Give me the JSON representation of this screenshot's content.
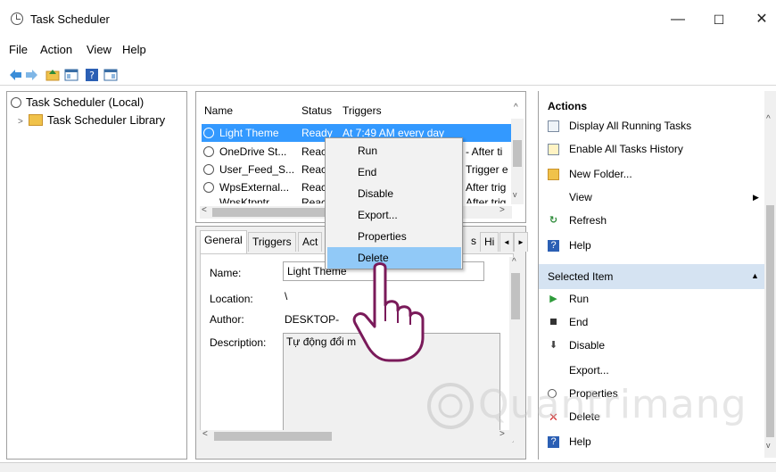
{
  "window": {
    "title": "Task Scheduler",
    "minimize": "—",
    "maximize": "☐",
    "close": "✕"
  },
  "menu": [
    "File",
    "Action",
    "View",
    "Help"
  ],
  "tree": {
    "root": "Task Scheduler (Local)",
    "library": "Task Scheduler Library"
  },
  "task_list": {
    "columns": [
      "Name",
      "Status",
      "Triggers"
    ],
    "rows": [
      {
        "name": "Light Theme",
        "status": "Ready",
        "trigger": "At 7:49 AM every day"
      },
      {
        "name": "OneDrive St...",
        "status": "Reac",
        "trigger": "- After ti"
      },
      {
        "name": "User_Feed_S...",
        "status": "Reac",
        "trigger": "Trigger e"
      },
      {
        "name": "WpsExternal...",
        "status": "Reac",
        "trigger": "After trig"
      },
      {
        "name": "WpsKtpntr...",
        "status": "Reac",
        "trigger": "After trig"
      }
    ]
  },
  "detail": {
    "tabs": [
      "General",
      "Triggers",
      "Act",
      "s",
      "Hi"
    ],
    "labels": {
      "name": "Name:",
      "location": "Location:",
      "author": "Author:",
      "description": "Description:"
    },
    "values": {
      "name": "Light Theme",
      "location": "\\",
      "author": "DESKTOP-",
      "description": "Tự động đổi m"
    }
  },
  "context_menu": [
    "Run",
    "End",
    "Disable",
    "Export...",
    "Properties",
    "Delete"
  ],
  "context_menu_highlighted": "Delete",
  "actions": {
    "header": "Actions",
    "items": [
      "Display All Running Tasks",
      "Enable All Tasks History",
      "New Folder...",
      "View",
      "Refresh",
      "Help"
    ],
    "selected_header": "Selected Item",
    "selected_items": [
      "Run",
      "End",
      "Disable",
      "Export...",
      "Properties",
      "Delete",
      "Help"
    ]
  },
  "watermark": "Quantrimang",
  "colors": {
    "selection": "#3399ff",
    "menu_highlight": "#91c9f7",
    "section_header": "#d5e3f2"
  }
}
